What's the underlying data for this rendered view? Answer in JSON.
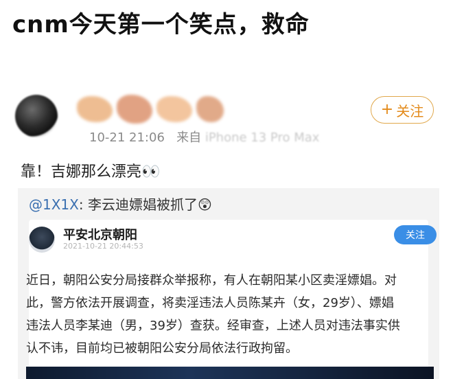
{
  "headline": "cnm今天第一个笑点，救命",
  "post": {
    "timestamp": "10-21 21:06",
    "source_prefix": "来自",
    "source_device": "iPhone 13 Pro Max",
    "follow_plus": "+",
    "follow_label": "关注",
    "text": "靠！吉娜那么漂亮👀",
    "quote": {
      "mention": "@1X1X",
      "text": ": 李云迪嫖娼被抓了😲",
      "card": {
        "account_name": "平安北京朝阳",
        "time": "2021-10-21 20:44:53",
        "follow_label": "关注",
        "body_lines": [
          "近日，朝阳公安分局接群众举报称，有人在朝阳某小区卖淫嫖娼。对",
          "此，警方依法开展调查，将卖淫违法人员陈某卉（女，29岁）、嫖娼",
          "违法人员李某迪（男，39岁）查获。经审查，上述人员对违法事实供",
          "认不讳，目前均已被朝阳公安分局依法行政拘留。"
        ]
      }
    }
  },
  "colors": {
    "follow_orange": "#e38a1a",
    "follow_blue": "#3a8ee6",
    "mention_blue": "#3a6fb0"
  }
}
